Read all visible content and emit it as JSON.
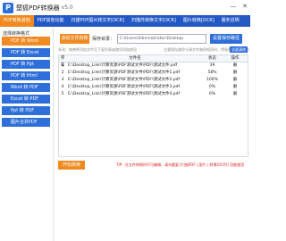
{
  "window": {
    "title": "楚狐PDF转换器",
    "version": "v5.0",
    "min": "—",
    "close": "✕"
  },
  "tabs": [
    {
      "label": "PDF转换其他",
      "active": true
    },
    {
      "label": "PDF其他功能",
      "active": false
    },
    {
      "label": "扫描PDF图片转文字[OCR]",
      "active": false
    },
    {
      "label": "扫描件转换文字[OCR]",
      "active": false
    },
    {
      "label": "图片转换[OCR]",
      "active": false
    },
    {
      "label": "服务说明",
      "active": false
    }
  ],
  "sidebar": {
    "header": "选择转换格式",
    "items": [
      {
        "label": "PDF 转 Word",
        "active": true
      },
      {
        "label": "PDF 转 Excel",
        "active": false
      },
      {
        "label": "PDF 转 Ppt",
        "active": false
      },
      {
        "label": "PDF 转 Html",
        "active": false
      },
      {
        "label": "Word 转 PDF",
        "active": false
      },
      {
        "label": "Excel 转 PDF",
        "active": false
      },
      {
        "label": "Ppt 转 PDF",
        "active": false
      },
      {
        "label": "图片合并PDF",
        "active": false
      }
    ]
  },
  "toolbar": {
    "add_button": "添加文件转换",
    "save_label": "保存目录：",
    "save_path": "C:\\Users\\Administrator\\Desktop",
    "folder_button": "设置保存路径"
  },
  "hint": {
    "left": "多选：拖拽将添加文件至下面列表或使用添加按钮",
    "right": "注意保存路径与源文件路径相同时，将复制过来重命名",
    "clear_button": "全部清除"
  },
  "table": {
    "headers": {
      "no": "序号",
      "name": "文件名",
      "status": "状态",
      "op": "操作"
    },
    "rows": [
      {
        "no": "1",
        "name": "E:\\Desktop_Link\\计算资源\\PDF测试文件\\PDF\\测试文件.pdf",
        "status": "39",
        "op": "删"
      },
      {
        "no": "2",
        "name": "E:\\Desktop_Link\\计算资源\\PDF测试文件\\PDF\\测试文件1.pdf",
        "status": "58%",
        "op": "删"
      },
      {
        "no": "3",
        "name": "E:\\Desktop_Link\\计算资源\\PDF测试文件\\PDF\\测试文件2.pdf",
        "status": "100%",
        "op": "删"
      },
      {
        "no": "4",
        "name": "E:\\Desktop_Link\\计算资源\\PDF测试文件\\PDF\\测试文件3.pdf",
        "status": "0%",
        "op": "删"
      },
      {
        "no": "5",
        "name": "E:\\Desktop_Link\\计算资源\\PDF测试文件\\PDF\\测试文件4.pdf",
        "status": "0%",
        "op": "删"
      }
    ]
  },
  "bottom": {
    "start_button": "开始转换",
    "tip": "TIP：在文件转换时不可编辑，请勿重复 [扫描PDF | 图片 | 转换[OCR]] 功能使用"
  },
  "colors": {
    "primary": "#2459c4",
    "accent": "#f08a22",
    "tip": "#dd2222"
  }
}
